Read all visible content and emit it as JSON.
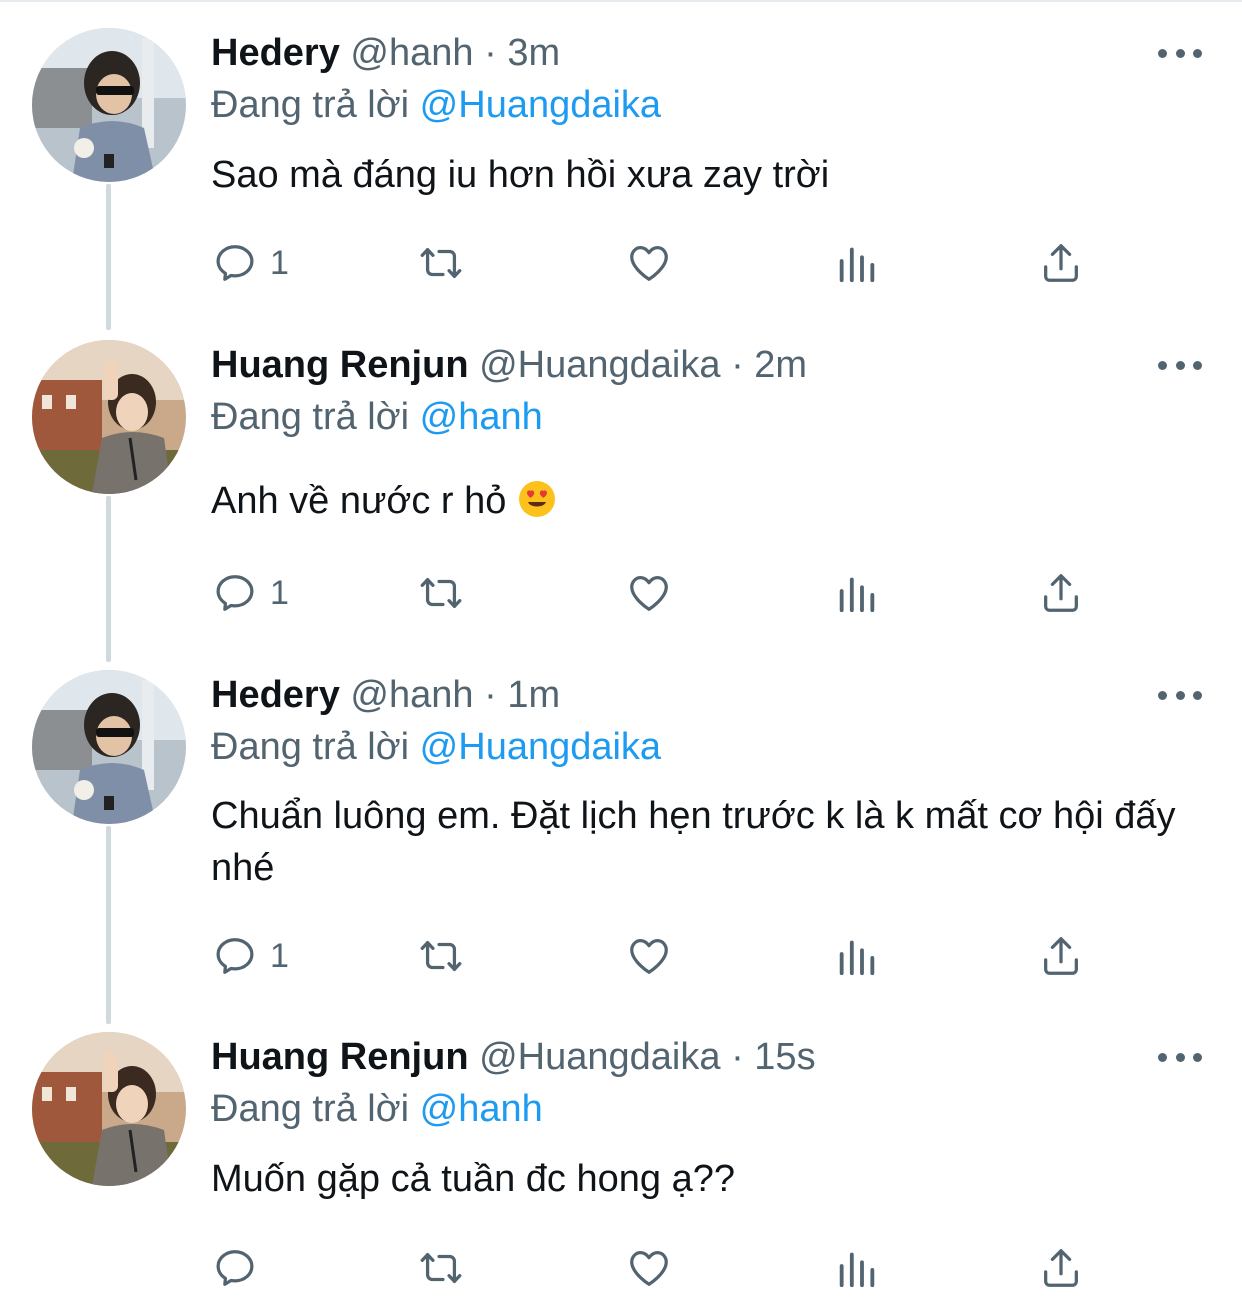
{
  "thread": [
    {
      "display_name": "Hedery",
      "handle": "@hanh",
      "separator": "·",
      "time": "3m",
      "replying_label": "Đang trả lời",
      "replying_to": "@Huangdaika",
      "text": "Sao mà đáng iu hơn hồi xưa zay trời",
      "reply_count": "1",
      "avatar_icon": "avatar-hedery"
    },
    {
      "display_name": "Huang Renjun",
      "handle": "@Huangdaika",
      "separator": "·",
      "time": "2m",
      "replying_label": "Đang trả lời",
      "replying_to": "@hanh",
      "text": "Anh về nước r hỏ",
      "emoji_icon": "heart-eyes-emoji",
      "reply_count": "1",
      "avatar_icon": "avatar-renjun"
    },
    {
      "display_name": "Hedery",
      "handle": "@hanh",
      "separator": "·",
      "time": "1m",
      "replying_label": "Đang trả lời",
      "replying_to": "@Huangdaika",
      "text": "Chuẩn luông em. Đặt lịch hẹn trước k là k mất cơ hội đấy nhé",
      "reply_count": "1",
      "avatar_icon": "avatar-hedery"
    },
    {
      "display_name": "Huang Renjun",
      "handle": "@Huangdaika",
      "separator": "·",
      "time": "15s",
      "replying_label": "Đang trả lời",
      "replying_to": "@hanh",
      "text": "Muốn gặp cả tuần đc hong ạ??",
      "reply_count": "",
      "avatar_icon": "avatar-renjun"
    }
  ],
  "colors": {
    "text_primary": "#0f1419",
    "text_secondary": "#536471",
    "mention": "#1d9bf0",
    "thread_line": "#cfd9de"
  },
  "icons": [
    "reply-icon",
    "retweet-icon",
    "like-icon",
    "analytics-icon",
    "share-icon",
    "more-icon"
  ]
}
